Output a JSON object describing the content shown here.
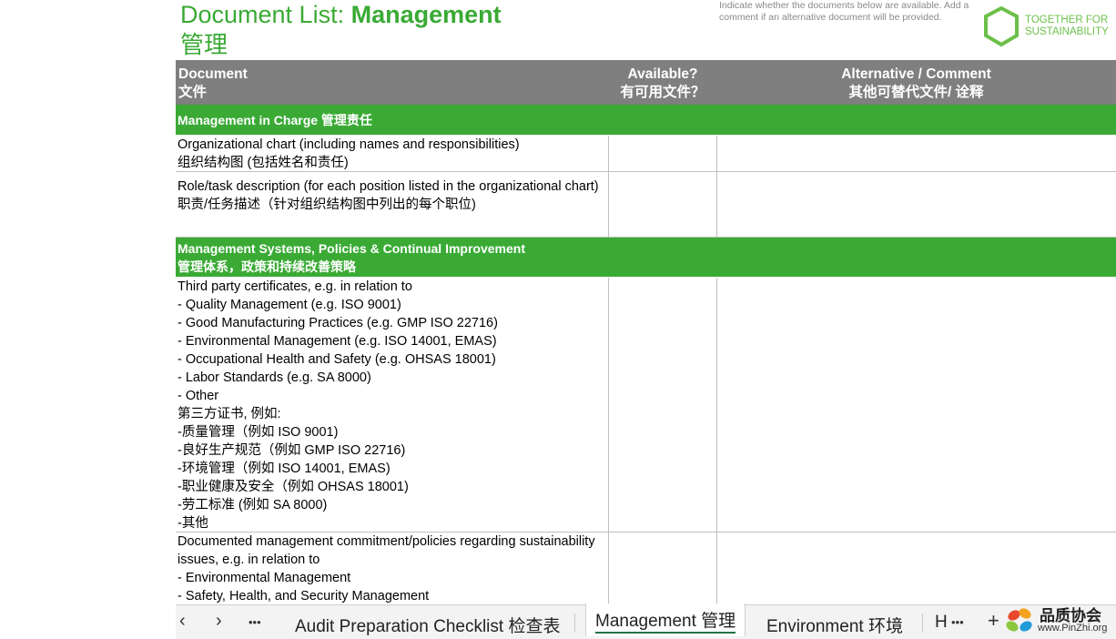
{
  "title": {
    "prefix": "Document List: ",
    "bold": "Management",
    "chinese": "管理"
  },
  "hint": "Indicate whether the documents below are available.  Add a comment if an alternative document will be provided.",
  "logo": {
    "line1": "TOGETHER FOR",
    "line2": "SUSTAINABILITY",
    "color": "#6cc04a"
  },
  "header": {
    "document_en": "Document",
    "document_zh": "文件",
    "available_en": "Available?",
    "available_zh": "有可用文件？",
    "alt_en": "Alternative / Comment",
    "alt_zh": "其他可替代文件/ 诠释"
  },
  "sections": [
    {
      "lines": [
        "Management in Charge 管理责任"
      ]
    },
    {
      "lines": [
        "Management Systems,  Policies  & Continual Improvement",
        "管理体系，政策和持续改善策略"
      ]
    }
  ],
  "rows": [
    {
      "lines": [
        "Organizational chart (including names and responsibilities)",
        "组织结构图 (包括姓名和责任)"
      ]
    },
    {
      "lines": [
        "",
        "Role/task description (for each position listed in the organizational chart)",
        "职责/任务描述（针对组织结构图中列出的每个职位)"
      ]
    },
    {
      "lines": [
        "Third party certificates, e.g. in relation to",
        "- Quality Management (e.g. ISO 9001)",
        "- Good Manufacturing Practices (e.g. GMP ISO 22716)",
        "- Environmental Management (e.g. ISO 14001, EMAS)",
        "- Occupational Health and Safety (e.g. OHSAS 18001)",
        "- Labor Standards (e.g. SA 8000)",
        "- Other",
        "第三方证书, 例如:",
        "-质量管理（例如  ISO 9001)",
        "-良好生产规范（例如  GMP ISO 22716)",
        "-环境管理（例如    ISO 14001, EMAS)",
        "-职业健康及安全（例如  OHSAS 18001)",
        "-劳工标准    (例如  SA 8000)",
        "-其他"
      ]
    },
    {
      "lines": [
        "Documented management commitment/policies regarding sustainability",
        "issues, e.g. in relation to",
        "- Environmental Management",
        "- Safety, Health, and Security Management"
      ]
    }
  ],
  "tabs": {
    "prev": "‹",
    "next": "›",
    "more_left": "•••",
    "items": [
      "Audit Preparation Checklist 检查表",
      "Management 管理",
      "Environment 环境",
      "H"
    ],
    "more_right": "•••",
    "add": "+"
  },
  "watermark": {
    "title": "品质协会",
    "url": "www.PinZhi.org"
  },
  "colors": {
    "accent": "#3aaa35",
    "header_bg": "#7f7f7f",
    "grid": "#bfbfbf"
  }
}
